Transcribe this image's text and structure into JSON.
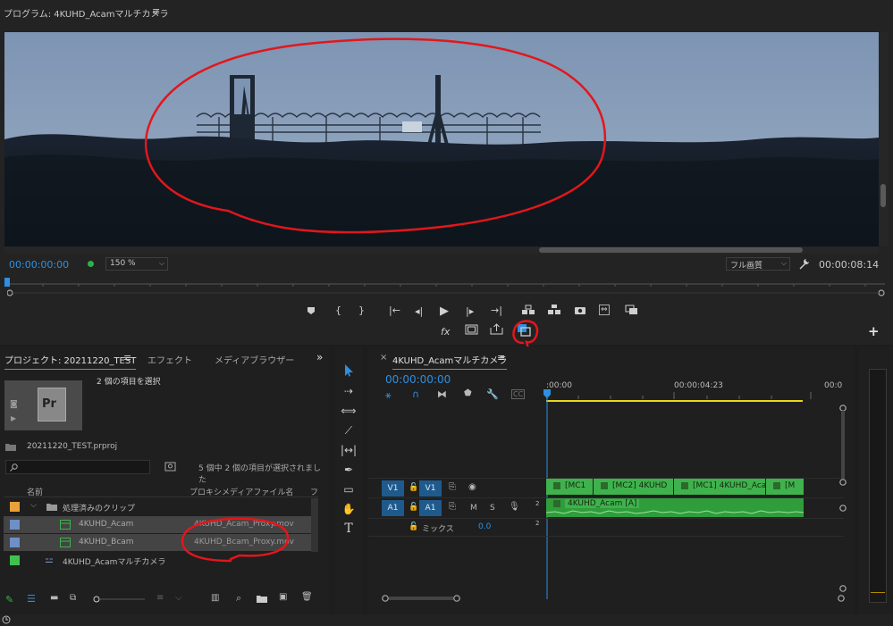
{
  "program_monitor": {
    "title": "プログラム: 4KUHD_Acamマルチカメラ",
    "menu_icon": "hamburger-icon",
    "timecode_current": "00:00:00:00",
    "zoom": "150 %",
    "quality": "フル画質",
    "timecode_duration": "00:00:08:14",
    "controls_row1": [
      "marker",
      "in",
      "out",
      "go-in",
      "step-back",
      "play",
      "step-forward",
      "go-out",
      "lift",
      "extract",
      "export-frame",
      "proxy-toggle",
      "comparison"
    ],
    "controls_row2": [
      "fx",
      "safe-margins",
      "export",
      "multicam-toggle"
    ],
    "add_label": "+"
  },
  "project": {
    "tabs": [
      "プロジェクト: 20211220_TEST",
      "エフェクト",
      "メディアブラウザー"
    ],
    "more_label": "»",
    "selection_text": "2 個の項目を選択",
    "file_name": "20211220_TEST.prproj",
    "status_text": "5 個中 2 個の項目が選択されました",
    "columns": [
      "名前",
      "プロキシメディアファイル名",
      "フ"
    ],
    "items": [
      {
        "name": "処理済みのクリップ",
        "proxy": "",
        "color": "#e8a23a",
        "type": "folder"
      },
      {
        "name": "4KUHD_Acam",
        "proxy": "4KUHD_Acam_Proxy.mov",
        "color": "#6f8fc7",
        "type": "clip",
        "selected": true
      },
      {
        "name": "4KUHD_Bcam",
        "proxy": "4KUHD_Bcam_Proxy.mov",
        "color": "#6f8fc7",
        "type": "clip",
        "selected": true
      },
      {
        "name": "4KUHD_Acamマルチカメラ",
        "proxy": "",
        "color": "#3fc04f",
        "type": "sequence"
      }
    ],
    "thumb_label": "Pr"
  },
  "timeline": {
    "close_label": "×",
    "sequence_name": "4KUHD_Acamマルチカメラ",
    "timecode": "00:00:00:00",
    "ruler_labels": [
      ":00:00",
      "00:00:04:23",
      "00:0"
    ],
    "tracks": {
      "v1": {
        "source": "V1",
        "target": "V1"
      },
      "a1": {
        "source": "A1",
        "target": "A1",
        "m": "M",
        "s": "S",
        "ch": "2"
      },
      "mix": {
        "label": "ミックス",
        "value": "0.0",
        "ch": "2"
      }
    },
    "video_clips": [
      "[MC1",
      "[MC2] 4KUHD",
      "[MC1] 4KUHD_Aca",
      "[M"
    ],
    "audio_clip": "4KUHD_Acam [A]"
  },
  "colors": {
    "accent_blue": "#2f8fe0",
    "clip_green": "#3fb24d",
    "annotation_red": "#e3161b"
  }
}
